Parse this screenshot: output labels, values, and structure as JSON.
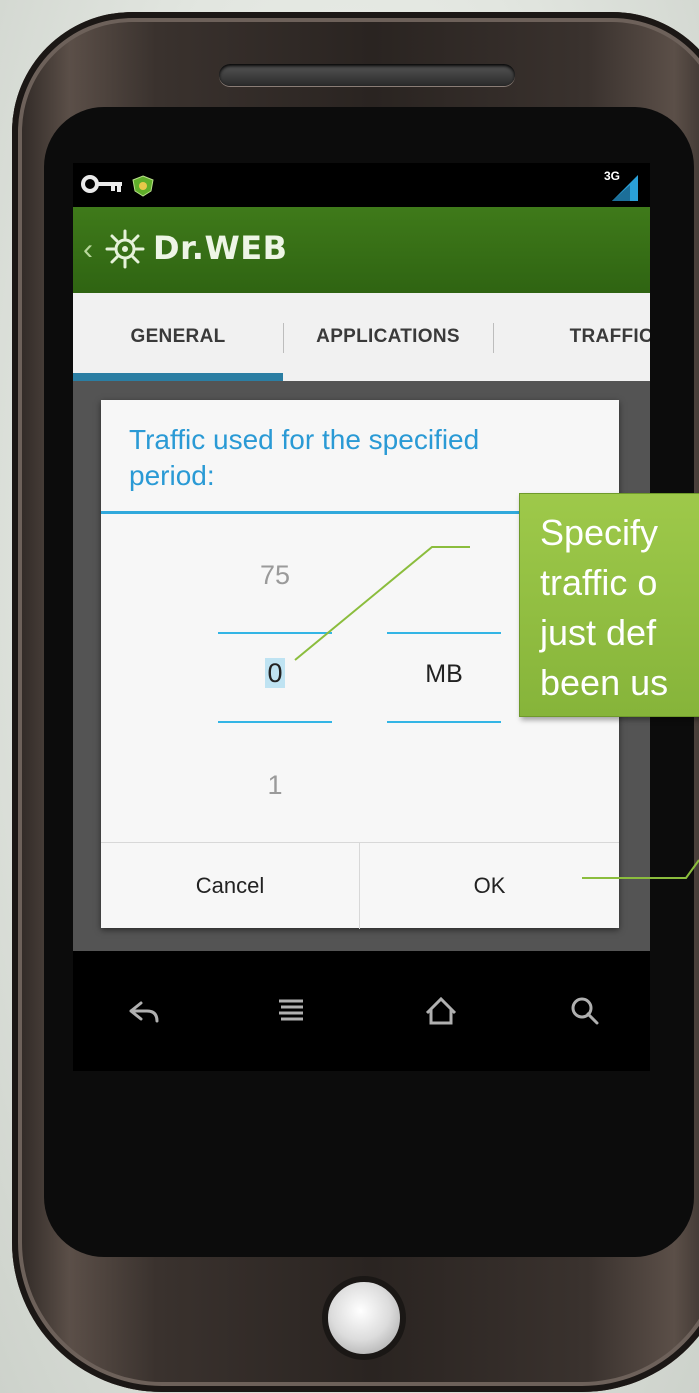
{
  "statusbar": {
    "network": "3G",
    "icons": [
      "key-icon",
      "drweb-shield-icon",
      "signal-3g-icon"
    ]
  },
  "actionbar": {
    "title": "Dr.WEB",
    "icons": [
      "back-chevron-icon",
      "drweb-spider-logo-icon"
    ]
  },
  "tabs": [
    {
      "label": "GENERAL",
      "selected": true
    },
    {
      "label": "APPLICATIONS",
      "selected": false
    },
    {
      "label": "TRAFFIC",
      "selected": false
    }
  ],
  "dialog": {
    "title": "Traffic used for the specified period:",
    "value_picker": {
      "previous": "75",
      "current": "0",
      "next": "1"
    },
    "unit_picker": {
      "current": "MB"
    },
    "cancel_label": "Cancel",
    "ok_label": "OK"
  },
  "callout": {
    "text": "Specify\ntraffic o\njust def\nbeen us"
  },
  "navbar": {
    "icons": [
      "back-icon",
      "menu-icon",
      "home-icon",
      "search-icon"
    ]
  },
  "colors": {
    "actionbar": "#2f6412",
    "accent": "#33b5e5",
    "tab_indicator": "#2b7ea3",
    "callout": "#8fbc3f"
  }
}
